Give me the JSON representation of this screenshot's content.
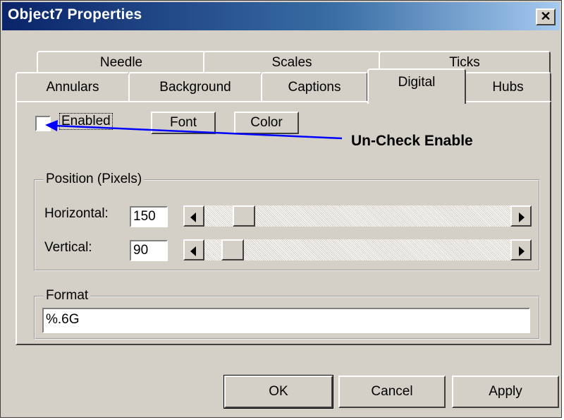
{
  "window": {
    "title": "Object7 Properties",
    "close_glyph": "✕"
  },
  "tabs": {
    "row1": [
      "Needle",
      "Scales",
      "Ticks"
    ],
    "row2": [
      "Annulars",
      "Background",
      "Captions",
      "Digital",
      "Hubs"
    ],
    "active": "Digital"
  },
  "digital": {
    "enabled_label": "Enabled",
    "enabled_checked": false,
    "font_button": "Font",
    "color_button": "Color",
    "position": {
      "legend": "Position (Pixels)",
      "horizontal_label": "Horizontal:",
      "horizontal_value": "150",
      "horizontal_fraction": 0.1,
      "vertical_label": "Vertical:",
      "vertical_value": "90",
      "vertical_fraction": 0.06
    },
    "format": {
      "legend": "Format",
      "value": "%.6G"
    }
  },
  "annotation": {
    "text": "Un-Check Enable",
    "arrow_color": "#0000ff"
  },
  "buttons": {
    "ok": "OK",
    "cancel": "Cancel",
    "apply": "Apply"
  },
  "colors": {
    "face": "#d4d0c8",
    "title_start": "#0a246a",
    "title_end": "#a6caf0"
  }
}
